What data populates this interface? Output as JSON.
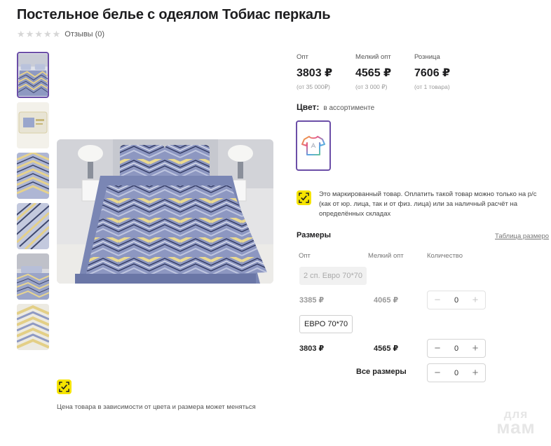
{
  "product": {
    "title": "Постельное белье с одеялом Тобиас перкаль",
    "rating_stars": 0,
    "reviews": "Отзывы (0)"
  },
  "prices": [
    {
      "label": "Опт",
      "value": "3803 ₽",
      "sub": "(от 35 000₽)"
    },
    {
      "label": "Мелкий опт",
      "value": "4565 ₽",
      "sub": "(от 3 000 ₽)"
    },
    {
      "label": "Розница",
      "value": "7606 ₽",
      "sub": "(от 1 товара)"
    }
  ],
  "color": {
    "label": "Цвет:",
    "value": "в ассортименте",
    "icon": "tshirt-icon"
  },
  "notice": "Это маркированный товар. Оплатить такой товар можно только на р/с (как от юр. лица, так и от физ. лица) или за наличный расчёт на определённых складах",
  "sizes": {
    "title": "Размеры",
    "table_link": "Таблица размеро",
    "columns": [
      "Опт",
      "Мелкий опт",
      "Количество"
    ],
    "rows": [
      {
        "name": "2 сп. Евро 70*70",
        "opt": "3385 ₽",
        "small_opt": "4065 ₽",
        "qty": "0",
        "available": false
      },
      {
        "name": "ЕВРО 70*70",
        "opt": "3803 ₽",
        "small_opt": "4565 ₽",
        "qty": "0",
        "available": true
      }
    ],
    "all_label": "Все размеры",
    "all_qty": "0"
  },
  "price_note": "Цена товара в зависимости от цвета и размера может меняться",
  "watermark": {
    "top": "для",
    "bottom": "мам"
  },
  "colors": {
    "accent": "#6b4ea7",
    "mark_yellow": "#f5e400"
  }
}
